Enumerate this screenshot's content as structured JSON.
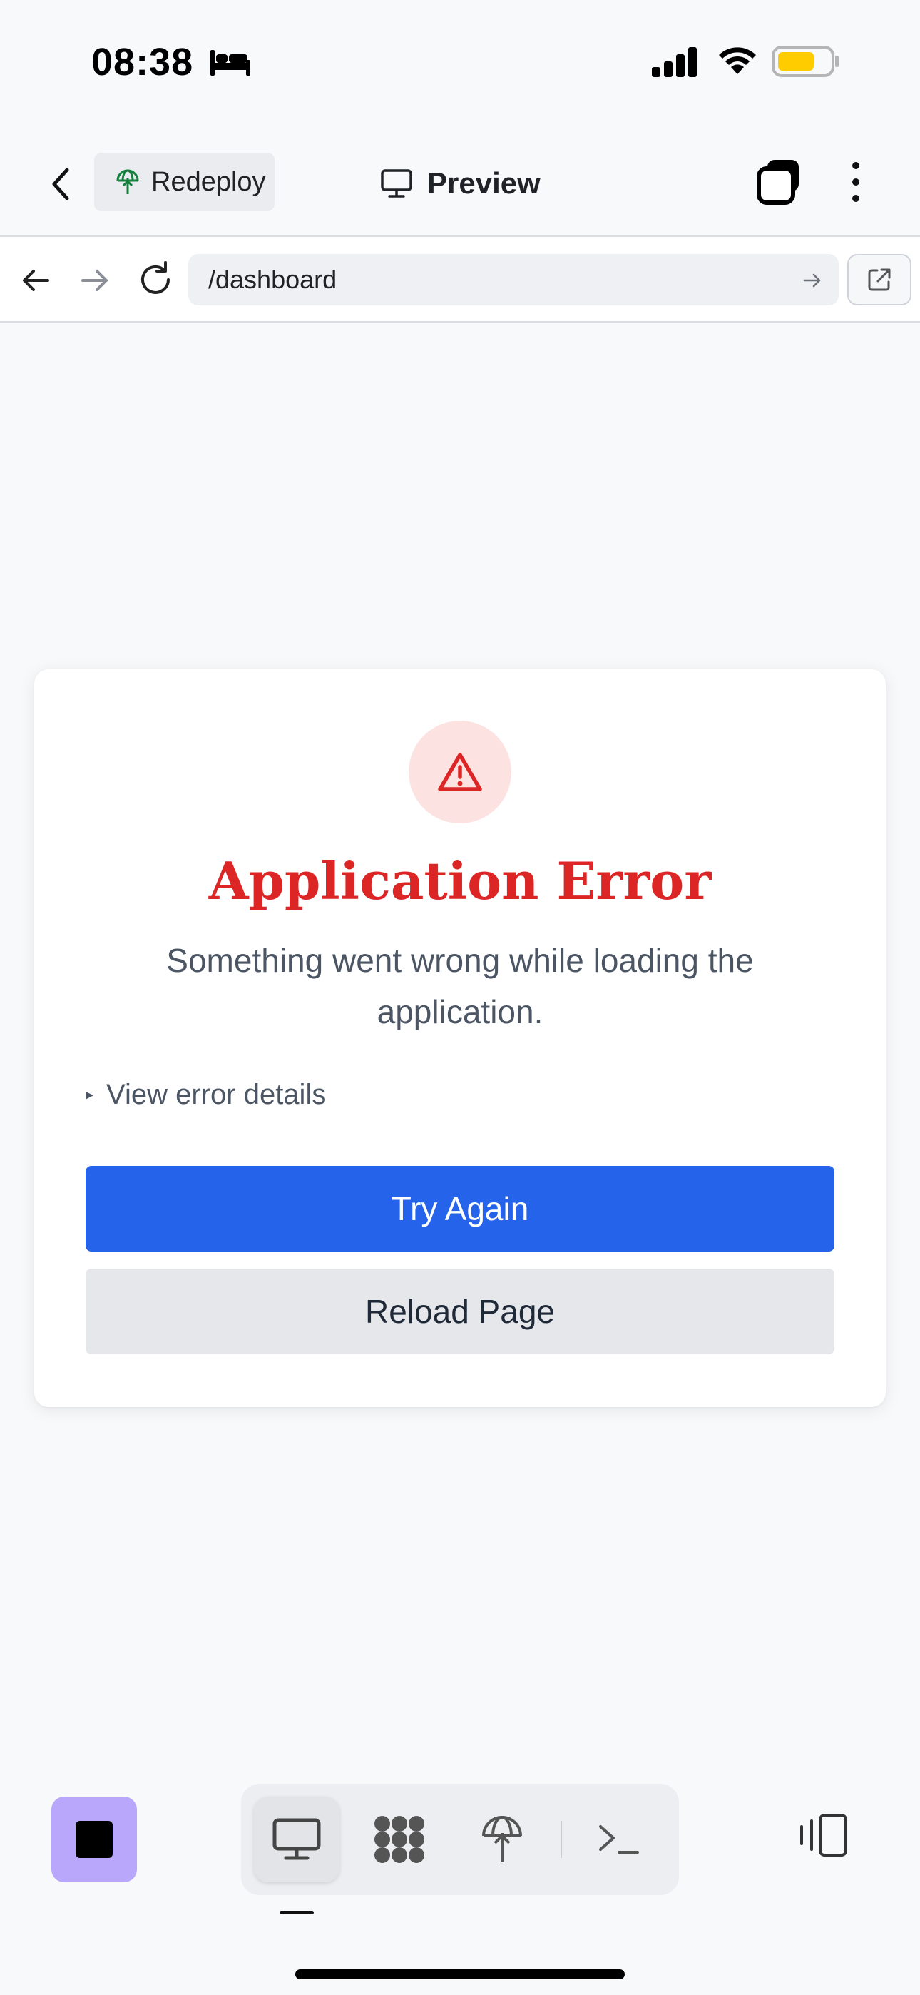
{
  "status_bar": {
    "time": "08:38",
    "focus_icon": "bed-icon",
    "battery_color": "#ffcc00"
  },
  "header": {
    "back_icon": "chevron-left-icon",
    "redeploy_label": "Redeploy",
    "redeploy_icon": "globe-upload-icon",
    "title": "Preview",
    "title_icon": "monitor-icon",
    "tabs_icon": "tabs-icon",
    "more_icon": "more-vertical-icon"
  },
  "browser": {
    "url": "/dashboard",
    "back_icon": "arrow-left-icon",
    "forward_icon": "arrow-right-icon",
    "reload_icon": "reload-icon",
    "go_icon": "arrow-right-icon",
    "external_icon": "external-link-icon"
  },
  "error_card": {
    "icon": "warning-triangle-icon",
    "title": "Application Error",
    "message": "Something went wrong while loading the application.",
    "details_marker": "▸",
    "details_label": "View error details",
    "try_again_label": "Try Again",
    "reload_label": "Reload Page",
    "colors": {
      "title": "#dc2626",
      "primary_button": "#2563eb",
      "secondary_button": "#e5e7eb"
    }
  },
  "bottom_bar": {
    "stop_color": "#b9a7fb",
    "tools": [
      "monitor-icon",
      "apps-icon",
      "globe-upload-icon",
      "terminal-icon"
    ],
    "active_tool": "monitor-icon",
    "panel_icon": "panel-toggle-icon"
  }
}
